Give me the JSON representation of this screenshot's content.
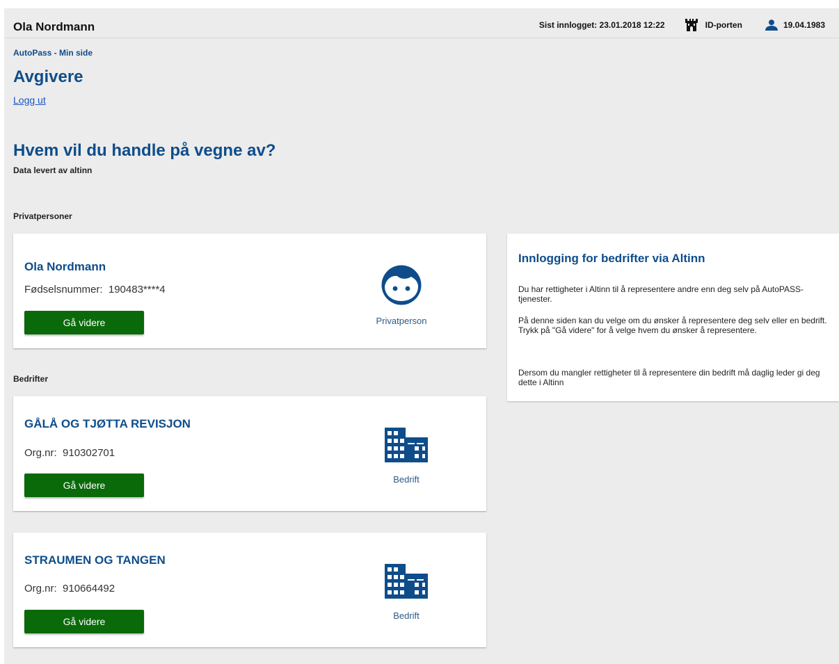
{
  "header": {
    "user_name": "Ola Nordmann",
    "last_login": "Sist innlogget: 23.01.2018 12:22",
    "idporten_label": "ID-porten",
    "birth_date": "19.04.1983",
    "icons": [
      "castle-icon",
      "person-icon"
    ]
  },
  "breadcrumb": "AutoPass - Min side",
  "page_title": "Avgivere",
  "logout_label": "Logg ut",
  "question": "Hvem vil du handle på vegne av?",
  "source": "Data levert av altinn",
  "private_section": {
    "label": "Privatpersoner",
    "card": {
      "name": "Ola Nordmann",
      "id_label": "Fødselsnummer:",
      "id_value": "190483****4",
      "button_label": "Gå videre",
      "type_label": "Privatperson",
      "icon": "face-icon"
    }
  },
  "business_section": {
    "label": "Bedrifter",
    "cards": [
      {
        "name": "GÅLÅ OG TJØTTA REVISJON",
        "id_label": "Org.nr:",
        "id_value": "910302701",
        "button_label": "Gå videre",
        "type_label": "Bedrift",
        "icon": "building-icon"
      },
      {
        "name": "STRAUMEN OG TANGEN",
        "id_label": "Org.nr:",
        "id_value": "910664492",
        "button_label": "Gå videre",
        "type_label": "Bedrift",
        "icon": "building-icon"
      }
    ]
  },
  "info_panel": {
    "title": "Innlogging for bedrifter via Altinn",
    "p1": "Du har rettigheter i Altinn til å representere andre enn deg selv på AutoPASS-tjenester.",
    "p2_line1": "På denne siden kan du velge om du ønsker å representere deg selv eller en bedrift.",
    "p2_line2": "Trykk på \"Gå videre\" for å velge hvem du ønsker å representere.",
    "p3": "Dersom du mangler rettigheter til å representere din bedrift må daglig leder gi deg dette i Altinn"
  },
  "colors": {
    "brand_blue": "#0e4d8a",
    "button_green": "#0a6a0a",
    "page_bg": "#ececec",
    "link_blue": "#1a55c6"
  }
}
